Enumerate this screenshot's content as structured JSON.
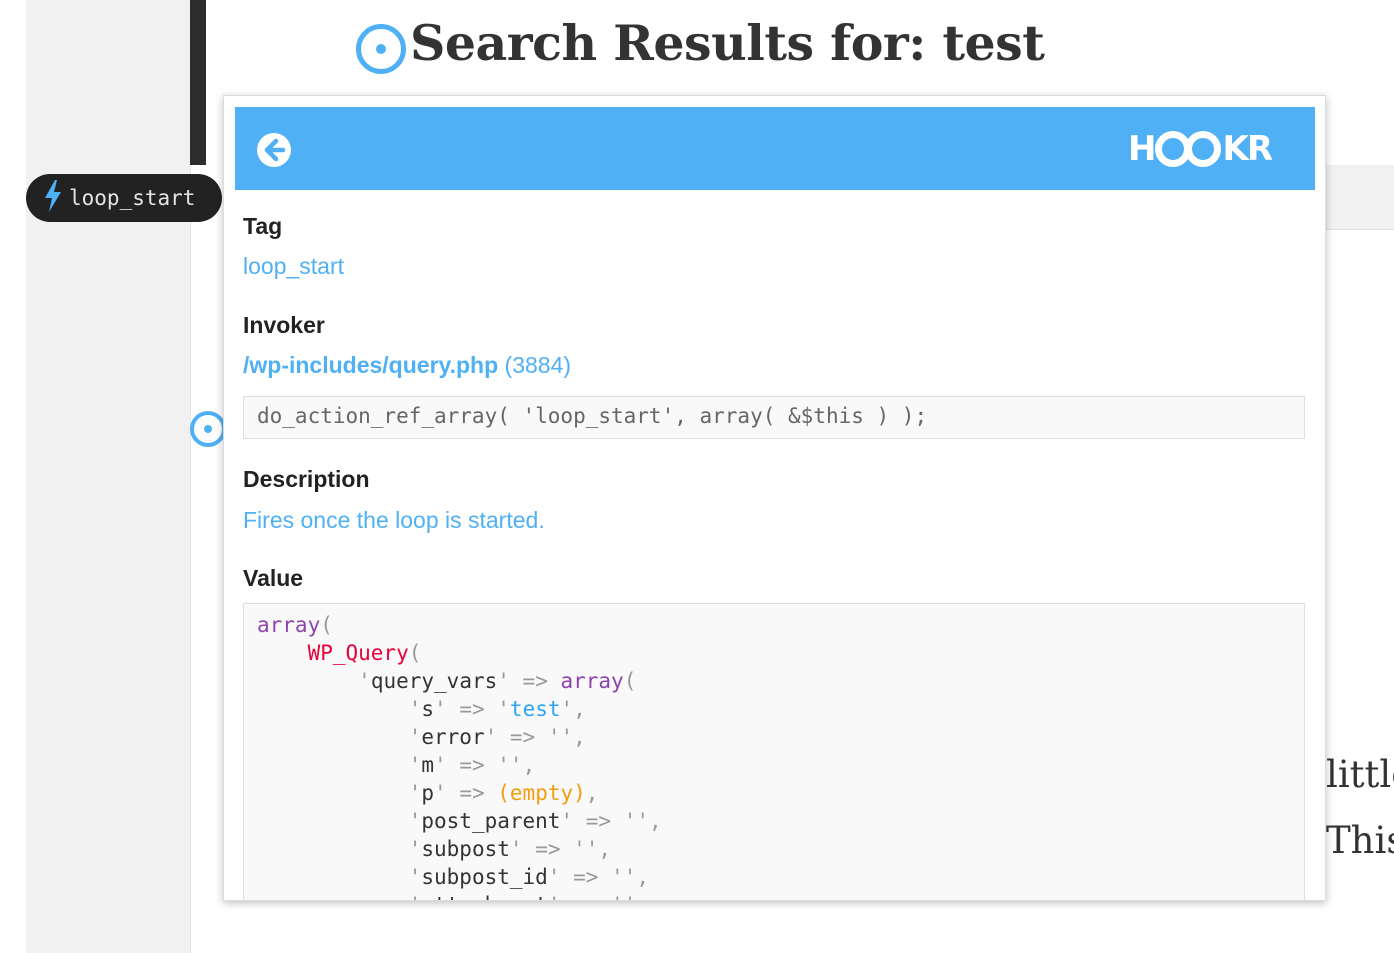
{
  "page": {
    "title": "Search Results for: test",
    "bg_text_1": "little",
    "bg_text_2": "This"
  },
  "hook_pill": {
    "icon": "lightning-bolt-icon",
    "label": "loop_start"
  },
  "panel": {
    "brand": {
      "pre": "H",
      "post": "KR"
    },
    "back_icon": "back-arrow-icon",
    "tag": {
      "label": "Tag",
      "value": "loop_start"
    },
    "invoker": {
      "label": "Invoker",
      "file": "/wp-includes/query.php",
      "line": "(3884)",
      "code": "do_action_ref_array( 'loop_start', array( &$this ) );"
    },
    "description": {
      "label": "Description",
      "text": "Fires once the loop is started."
    },
    "value": {
      "label": "Value",
      "lines": [
        {
          "indent": "",
          "key": "",
          "value": "array(",
          "type": "kw"
        },
        {
          "indent": "    ",
          "key": "",
          "value": "WP_Query(",
          "type": "cls"
        },
        {
          "indent": "        ",
          "key": "query_vars",
          "value": "array(",
          "type": "kw",
          "suffix": ""
        },
        {
          "indent": "            ",
          "key": "s",
          "value": "'test'",
          "type": "str",
          "suffix": ","
        },
        {
          "indent": "            ",
          "key": "error",
          "value": "''",
          "type": "quote",
          "suffix": ","
        },
        {
          "indent": "            ",
          "key": "m",
          "value": "''",
          "type": "quote",
          "suffix": ","
        },
        {
          "indent": "            ",
          "key": "p",
          "value": "(empty)",
          "type": "empty",
          "suffix": ","
        },
        {
          "indent": "            ",
          "key": "post_parent",
          "value": "''",
          "type": "quote",
          "suffix": ","
        },
        {
          "indent": "            ",
          "key": "subpost",
          "value": "''",
          "type": "quote",
          "suffix": ","
        },
        {
          "indent": "            ",
          "key": "subpost_id",
          "value": "''",
          "type": "quote",
          "suffix": ","
        },
        {
          "indent": "            ",
          "key": "attachment",
          "value": "''",
          "type": "quote",
          "suffix": ","
        }
      ]
    }
  },
  "colors": {
    "accent": "#4fb0f6",
    "dark": "#222222",
    "keyword": "#8e44ad",
    "class": "#e8003a",
    "empty": "#f39c12"
  }
}
